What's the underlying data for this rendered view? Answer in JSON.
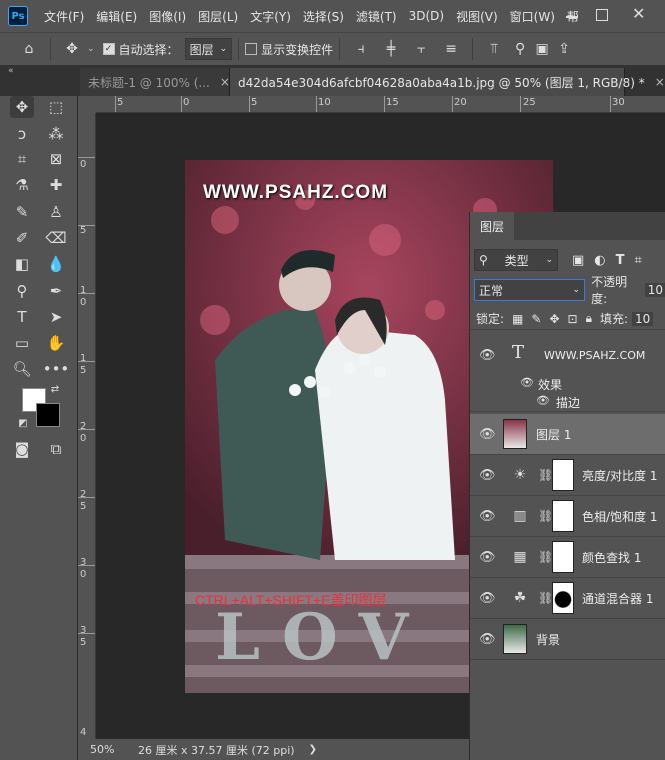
{
  "menubar": {
    "app_logo": "Ps",
    "items": [
      "文件(F)",
      "编辑(E)",
      "图像(I)",
      "图层(L)",
      "文字(Y)",
      "选择(S)",
      "滤镜(T)",
      "3D(D)",
      "视图(V)",
      "窗口(W)",
      "帮"
    ]
  },
  "options": {
    "auto_select_label": "自动选择：",
    "auto_select_value": "图层",
    "show_transform_label": "显示变换控件"
  },
  "tabs": [
    {
      "label": "未标题-1 @ 100% (...",
      "close": "×"
    },
    {
      "label": "d42da54e304d6afcbf04628a0aba4a1b.jpg @ 50% (图层 1, RGB/8) *",
      "close": "×"
    }
  ],
  "ruler": {
    "top": [
      "5",
      "0",
      "5",
      "10",
      "15",
      "20",
      "25",
      "30"
    ],
    "left": [
      "0",
      "5",
      "1 0",
      "1 5",
      "2 0",
      "2 5",
      "3 0",
      "3 5",
      "4"
    ]
  },
  "photo": {
    "watermark": "WWW.PSAHZ.COM",
    "overlay_caption": "CTRL+ALT+SHIFT+E盖印图层",
    "sign_letters": "LOV"
  },
  "status": {
    "zoom": "50%",
    "doc_size": "26 厘米 x 37.57 厘米 (72 ppi)"
  },
  "layers_panel": {
    "title": "图层",
    "filter_label": "类型",
    "blend_mode": "正常",
    "opacity_label": "不透明度:",
    "opacity_value": "10",
    "lock_label": "锁定:",
    "fill_label": "填充:",
    "fill_value": "10",
    "text_layer": "WWW.PSAHZ.COM",
    "effects_label": "效果",
    "stroke_label": "描边",
    "layers": [
      {
        "name": "图层 1",
        "type": "pixel"
      },
      {
        "name": "亮度/对比度 1",
        "type": "brightness"
      },
      {
        "name": "色相/饱和度 1",
        "type": "hue"
      },
      {
        "name": "颜色查找 1",
        "type": "lookup"
      },
      {
        "name": "通道混合器 1",
        "type": "mixer"
      },
      {
        "name": "背景",
        "type": "background"
      }
    ]
  },
  "colors": {
    "ps_blue": "#31a8ff",
    "caption_red": "#e8323c",
    "panel_bg": "#535353"
  }
}
